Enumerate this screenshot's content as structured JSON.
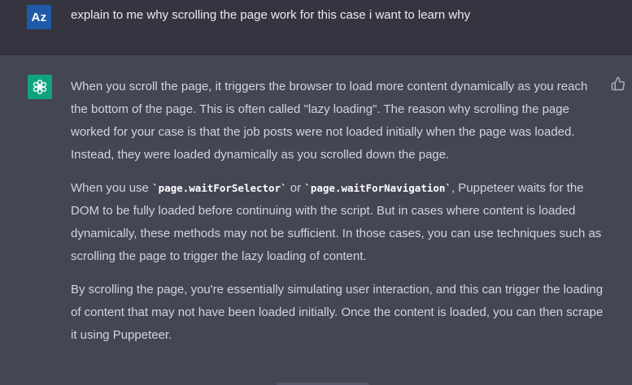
{
  "user_message": {
    "avatar_initials": "Az",
    "text": "explain to me why scrolling the page work for this case i want to learn why"
  },
  "assistant_message": {
    "avatar_icon": "openai-logo-icon",
    "feedback_icon": "thumbs-up-icon",
    "p1": "When you scroll the page, it triggers the browser to load more content dynamically as you reach the bottom of the page. This is often called \"lazy loading\". The reason why scrolling the page worked for your case is that the job posts were not loaded initially when the page was loaded. Instead, they were loaded dynamically as you scrolled down the page.",
    "p2_before": "When you use ",
    "code1": "`page.waitForSelector`",
    "p2_middle": " or ",
    "code2": "`page.waitForNavigation`",
    "p2_after": ", Puppeteer waits for the DOM to be fully loaded before continuing with the script. But in cases where content is loaded dynamically, these methods may not be sufficient. In those cases, you can use techniques such as scrolling the page to trigger the lazy loading of content.",
    "p3": "By scrolling the page, you're essentially simulating user interaction, and this can trigger the loading of content that may not have been loaded initially. Once the content is loaded, you can then scrape it using Puppeteer."
  },
  "colors": {
    "user_bg": "#343541",
    "assistant_bg": "#444654",
    "user_avatar": "#1e5aa8",
    "gpt_avatar": "#10a37f"
  }
}
